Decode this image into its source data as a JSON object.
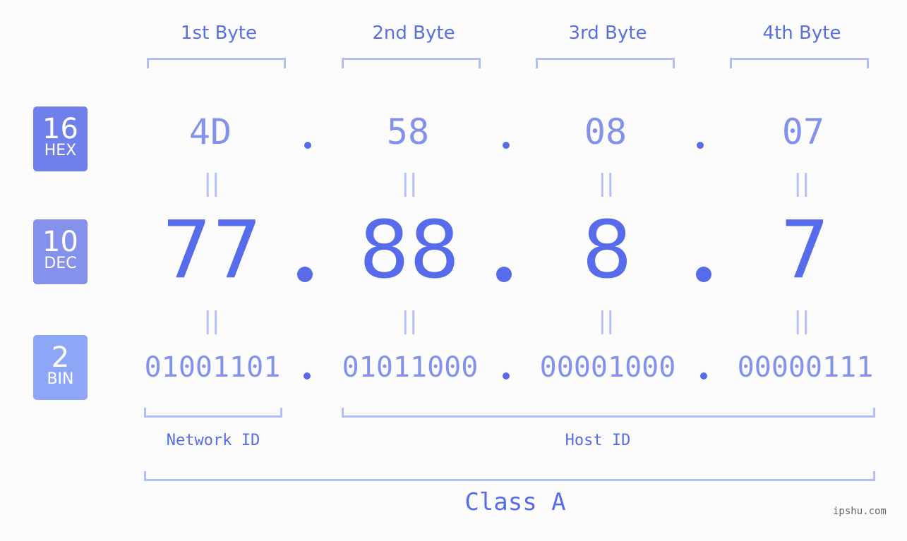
{
  "badges": [
    {
      "num": "16",
      "label": "HEX",
      "color": "#7080ea"
    },
    {
      "num": "10",
      "label": "DEC",
      "color": "#8592ec"
    },
    {
      "num": "2",
      "label": "BIN",
      "color": "#8ea6f6"
    }
  ],
  "byte_headers": [
    "1st Byte",
    "2nd Byte",
    "3rd Byte",
    "4th Byte"
  ],
  "hex": [
    "4D",
    "58",
    "08",
    "07"
  ],
  "dec": [
    "77",
    "88",
    "8",
    "7"
  ],
  "bin": [
    "01001101",
    "01011000",
    "00001000",
    "00000111"
  ],
  "separator": ".",
  "equals": "||",
  "network_label": "Network ID",
  "host_label": "Host ID",
  "class_label": "Class A",
  "watermark": "ipshu.com",
  "colors": {
    "accent": "#566ceb",
    "light": "#8592ec",
    "bracket": "#b3bdf6"
  }
}
